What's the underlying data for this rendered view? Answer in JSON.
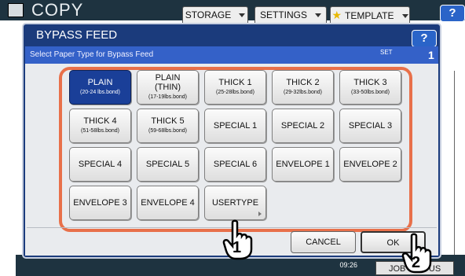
{
  "background": {
    "screen_title": "COPY",
    "tabs": [
      {
        "label": "STORAGE"
      },
      {
        "label": "SETTINGS"
      },
      {
        "label": "TEMPLATE"
      }
    ],
    "help_label": "?",
    "time": "09:26",
    "job_label": "JOB STATUS"
  },
  "dialog": {
    "title": "BYPASS FEED",
    "help_label": "?",
    "subheader": "Select Paper Type for Bypass Feed",
    "set_label": "SET",
    "set_count": "1",
    "paper_types": [
      {
        "label": "PLAIN",
        "range": "(20-24 lbs.bond)",
        "selected": true
      },
      {
        "label": "PLAIN\n(THIN)",
        "range": "(17-19lbs.bond)",
        "selected": false
      },
      {
        "label": "THICK 1",
        "range": "(25-28lbs.bond)",
        "selected": false
      },
      {
        "label": "THICK 2",
        "range": "(29-32lbs.bond)",
        "selected": false
      },
      {
        "label": "THICK 3",
        "range": "(33-50lbs.bond)",
        "selected": false
      },
      {
        "label": "THICK 4",
        "range": "(51-58lbs.bond)",
        "selected": false
      },
      {
        "label": "THICK 5",
        "range": "(59-68lbs.bond)",
        "selected": false
      },
      {
        "label": "SPECIAL 1",
        "range": "",
        "selected": false
      },
      {
        "label": "SPECIAL 2",
        "range": "",
        "selected": false
      },
      {
        "label": "SPECIAL 3",
        "range": "",
        "selected": false
      },
      {
        "label": "SPECIAL 4",
        "range": "",
        "selected": false
      },
      {
        "label": "SPECIAL 5",
        "range": "",
        "selected": false
      },
      {
        "label": "SPECIAL 6",
        "range": "",
        "selected": false
      },
      {
        "label": "ENVELOPE 1",
        "range": "",
        "selected": false
      },
      {
        "label": "ENVELOPE 2",
        "range": "",
        "selected": false
      },
      {
        "label": "ENVELOPE 3",
        "range": "",
        "selected": false
      },
      {
        "label": "ENVELOPE 4",
        "range": "",
        "selected": false
      },
      {
        "label": "USERTYPE",
        "range": "",
        "selected": false
      }
    ],
    "cancel_label": "CANCEL",
    "ok_label": "OK"
  },
  "callouts": [
    {
      "number": "1"
    },
    {
      "number": "2"
    }
  ],
  "colors": {
    "dialog_bg": "#1b3b7c",
    "subheader_bg": "#3461c8",
    "selected_button": "#1a3f98",
    "highlight_frame": "#e8704a",
    "help_button": "#2a64c8"
  }
}
